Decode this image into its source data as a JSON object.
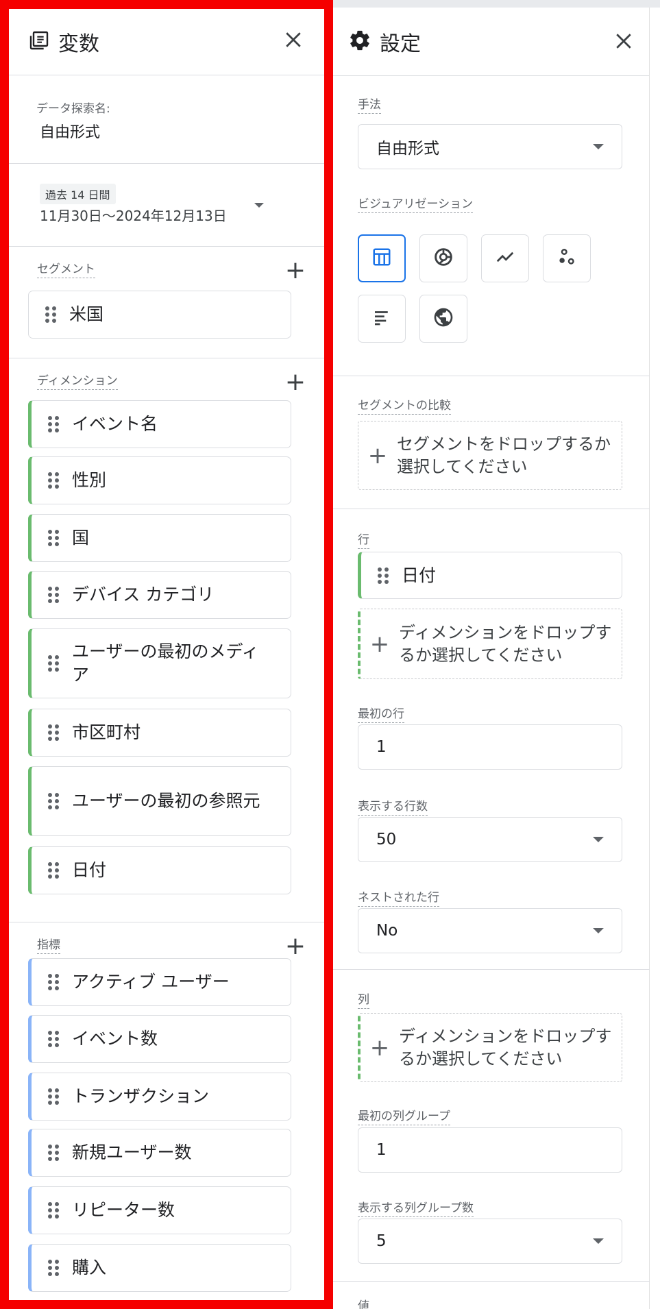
{
  "variables": {
    "title": "変数",
    "exploration_label": "データ探索名:",
    "exploration_name": "自由形式",
    "date_chip": "過去 14 日間",
    "date_range": "11月30日～2024年12月13日",
    "segments_label": "セグメント",
    "segments": [
      "米国"
    ],
    "dimensions_label": "ディメンション",
    "dimensions": [
      "イベント名",
      "性別",
      "国",
      "デバイス カテゴリ",
      "ユーザーの最初のメディア",
      "市区町村",
      "ユーザーの最初の参照元",
      "日付"
    ],
    "metrics_label": "指標",
    "metrics": [
      "アクティブ ユーザー",
      "イベント数",
      "トランザクション",
      "新規ユーザー数",
      "リピーター数",
      "購入"
    ]
  },
  "settings": {
    "title": "設定",
    "technique_label": "手法",
    "technique_value": "自由形式",
    "visualization_label": "ビジュアリゼーション",
    "segment_compare_label": "セグメントの比較",
    "segment_drop_text": "セグメントをドロップするか選択してください",
    "rows_label": "行",
    "row_item": "日付",
    "dimension_drop_text": "ディメンションをドロップするか選択してください",
    "first_row_label": "最初の行",
    "first_row_value": "1",
    "rows_shown_label": "表示する行数",
    "rows_shown_value": "50",
    "nested_rows_label": "ネストされた行",
    "nested_rows_value": "No",
    "columns_label": "列",
    "column_drop_text": "ディメンションをドロップするか選択してください",
    "first_col_group_label": "最初の列グループ",
    "first_col_group_value": "1",
    "col_groups_shown_label": "表示する列グループ数",
    "col_groups_shown_value": "5",
    "values_label": "値"
  },
  "colors": {
    "frame": "#f50000",
    "dimension_accent": "#6abb6e",
    "metric_accent": "#8ab4f8",
    "active": "#1a73e8"
  }
}
